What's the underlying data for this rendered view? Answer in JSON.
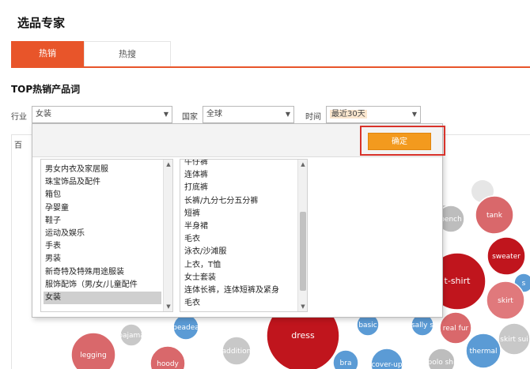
{
  "page": {
    "title": "选品专家"
  },
  "tabs": [
    {
      "label": "热销",
      "active": true
    },
    {
      "label": "热搜",
      "active": false
    }
  ],
  "section": {
    "title": "TOP热销产品词"
  },
  "filters": {
    "industry": {
      "label": "行业",
      "value": "女装"
    },
    "country": {
      "label": "国家",
      "value": "全球"
    },
    "time": {
      "label": "时间",
      "value": "最近30天"
    }
  },
  "panel": {
    "label": "百"
  },
  "dropdown": {
    "confirm_label": "确定",
    "left_list": [
      "男女内衣及家居服",
      "珠宝饰品及配件",
      "箱包",
      "孕婴童",
      "鞋子",
      "运动及娱乐",
      "手表",
      "男装",
      "新奇特及特殊用途服装",
      "服饰配饰（男/女/儿童配件",
      "女装"
    ],
    "left_selected": "女装",
    "right_list": [
      "牛仔裤",
      "连体裤",
      "打底裤",
      "长裤/九分七分五分裤",
      "短裤",
      "半身裙",
      "毛衣",
      "泳衣/沙滩服",
      "上衣，T恤",
      "女士套装",
      "连体长裤，连体短裤及紧身",
      "毛衣"
    ]
  },
  "bubbles": [
    {
      "label": "tank",
      "color": "#d9686b"
    },
    {
      "label": "bench",
      "color": "#bdbdbd"
    },
    {
      "label": "sweater",
      "color": "#c0151d"
    },
    {
      "label": "t-shirt",
      "color": "#c0151d"
    },
    {
      "label": "s",
      "color": "#5b9bd5"
    },
    {
      "label": "skirt",
      "color": "#e0797c"
    },
    {
      "label": "real fur",
      "color": "#d9686b"
    },
    {
      "label": "skirt sui",
      "color": "#c8c8c8"
    },
    {
      "label": "thermal",
      "color": "#5b9bd5"
    },
    {
      "label": "polo shi",
      "color": "#bdbdbd"
    },
    {
      "label": "dress",
      "color": "#c0151d"
    },
    {
      "label": "cover-up",
      "color": "#5b9bd5"
    },
    {
      "label": "bra",
      "color": "#5b9bd5"
    },
    {
      "label": "legging",
      "color": "#d9686b"
    },
    {
      "label": "hoody",
      "color": "#d9686b"
    },
    {
      "label": "pajama",
      "color": "#c8c8c8"
    },
    {
      "label": "peadea",
      "color": "#5b9bd5"
    },
    {
      "label": "addition",
      "color": "#c8c8c8"
    },
    {
      "label": "basic",
      "color": "#5b9bd5"
    },
    {
      "label": "sally s",
      "color": "#5b9bd5"
    }
  ]
}
